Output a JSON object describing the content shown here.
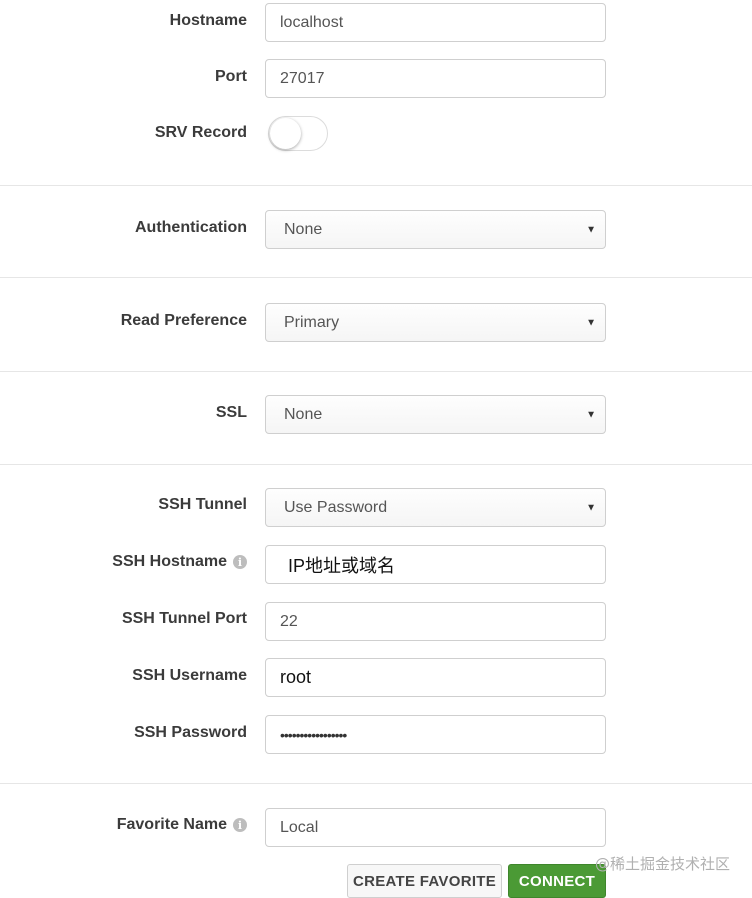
{
  "form": {
    "hostname": {
      "label": "Hostname",
      "value": "localhost"
    },
    "port": {
      "label": "Port",
      "value": "27017"
    },
    "srv_record": {
      "label": "SRV Record",
      "enabled": false
    },
    "authentication": {
      "label": "Authentication",
      "value": "None"
    },
    "read_preference": {
      "label": "Read Preference",
      "value": "Primary"
    },
    "ssl": {
      "label": "SSL",
      "value": "None"
    },
    "ssh_tunnel": {
      "label": "SSH Tunnel",
      "value": "Use Password"
    },
    "ssh_hostname": {
      "label": "SSH Hostname",
      "value": "IP地址或域名"
    },
    "ssh_tunnel_port": {
      "label": "SSH Tunnel Port",
      "value": "22"
    },
    "ssh_username": {
      "label": "SSH Username",
      "value": "root"
    },
    "ssh_password": {
      "label": "SSH Password",
      "value": "•••••••••••••••••"
    },
    "favorite_name": {
      "label": "Favorite Name",
      "value": "Local"
    }
  },
  "buttons": {
    "create_favorite": "CREATE FAVORITE",
    "connect": "CONNECT"
  },
  "icons": {
    "info": "i",
    "caret": "▼"
  },
  "watermark": "@稀土掘金技术社区",
  "colors": {
    "connect_green": "#4b9a35",
    "border": "#cfcfcf",
    "label": "#3b3b3b"
  }
}
